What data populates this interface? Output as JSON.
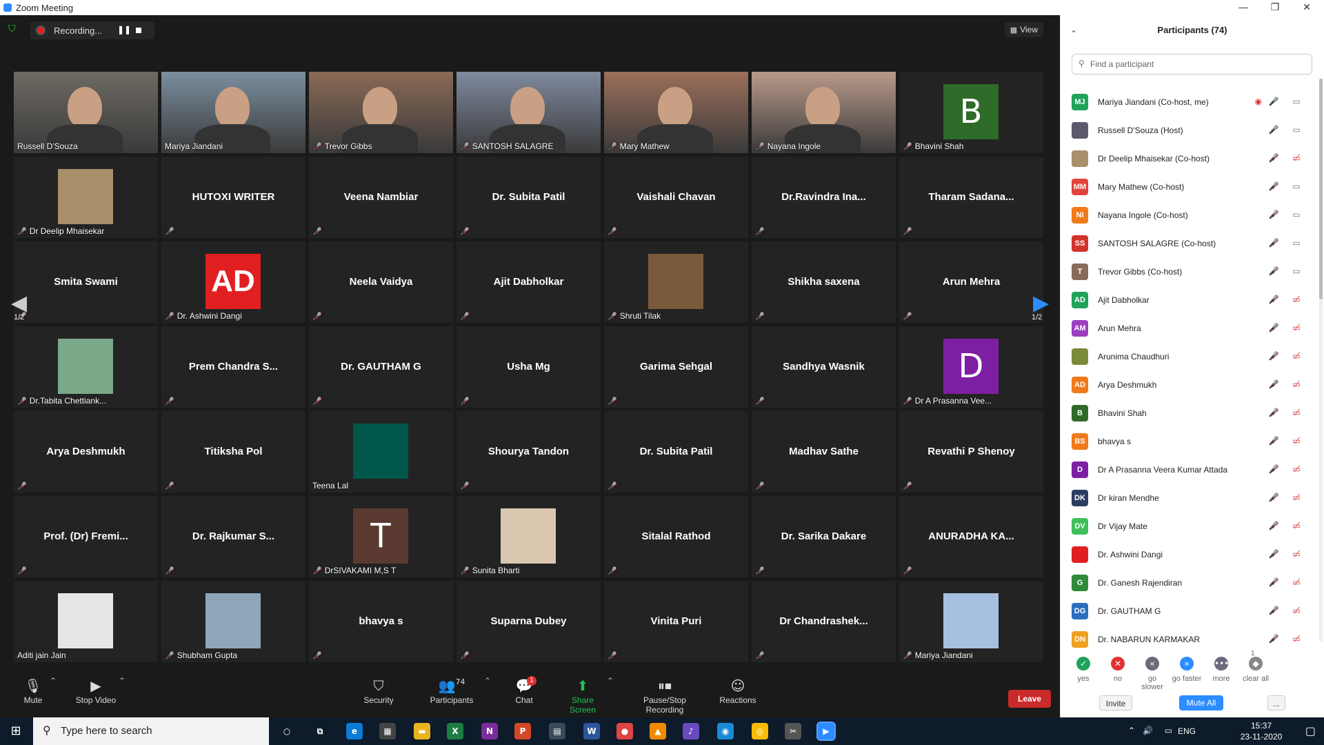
{
  "window": {
    "title": "Zoom Meeting"
  },
  "topbar": {
    "recording_label": "Recording...",
    "view_label": "View"
  },
  "pagination": {
    "left": "1/2",
    "right": "1/2"
  },
  "tiles": [
    {
      "name": "Russell D'Souza",
      "kind": "video",
      "muted": false,
      "bg": "#6e6a63"
    },
    {
      "name": "Mariya Jiandani",
      "kind": "video",
      "muted": false,
      "bg": "#7b8fa0",
      "active": true
    },
    {
      "name": "Trevor Gibbs",
      "kind": "video",
      "muted": true,
      "bg": "#8a6a55"
    },
    {
      "name": "SANTOSH SALAGRE",
      "kind": "video",
      "muted": true,
      "bg": "#7f8aa0"
    },
    {
      "name": "Mary Mathew",
      "kind": "video",
      "muted": true,
      "bg": "#9c6f5a"
    },
    {
      "name": "Nayana Ingole",
      "kind": "video",
      "muted": true,
      "bg": "#b99a8a"
    },
    {
      "name": "Bhavini Shah",
      "kind": "letter",
      "letter": "B",
      "color": "#2f6b28",
      "muted": true
    },
    {
      "name": "Dr Deelip Mhaisekar",
      "kind": "photo",
      "color": "#a98f6a",
      "muted": true
    },
    {
      "name": "HUTOXI WRITER",
      "kind": "text",
      "muted": true
    },
    {
      "name": "Veena Nambiar",
      "kind": "text",
      "muted": true
    },
    {
      "name": "Dr. Subita Patil",
      "kind": "text",
      "muted": true
    },
    {
      "name": "Vaishali Chavan",
      "kind": "text",
      "muted": true
    },
    {
      "name": "Dr.Ravindra  Ina...",
      "kind": "text",
      "muted": true
    },
    {
      "name": "Tharam  Sadana...",
      "kind": "text",
      "muted": true
    },
    {
      "name": "Smita Swami",
      "kind": "text",
      "muted": true
    },
    {
      "name": "Dr. Ashwini Dangi",
      "kind": "ad",
      "muted": true
    },
    {
      "name": "Neela Vaidya",
      "kind": "text",
      "muted": true
    },
    {
      "name": "Ajit Dabholkar",
      "kind": "text",
      "muted": true
    },
    {
      "name": "Shruti Tilak",
      "kind": "photo",
      "color": "#7a5a3a",
      "muted": true
    },
    {
      "name": "Shikha saxena",
      "kind": "text",
      "muted": true
    },
    {
      "name": "Arun Mehra",
      "kind": "text",
      "muted": true
    },
    {
      "name": "Dr.Tabita Chettiank...",
      "kind": "photo",
      "color": "#7aa98a",
      "muted": true
    },
    {
      "name": "Prem  Chandra  S...",
      "kind": "text",
      "muted": true
    },
    {
      "name": "Dr. GAUTHAM G",
      "kind": "text",
      "muted": true
    },
    {
      "name": "Usha Mg",
      "kind": "text",
      "muted": true
    },
    {
      "name": "Garima Sehgal",
      "kind": "text",
      "muted": true
    },
    {
      "name": "Sandhya Wasnik",
      "kind": "text",
      "muted": true
    },
    {
      "name": "Dr A Prasanna Vee...",
      "kind": "letter",
      "letter": "D",
      "color": "#7d1fa3",
      "muted": true
    },
    {
      "name": "Arya Deshmukh",
      "kind": "text",
      "muted": true
    },
    {
      "name": "Titiksha Pol",
      "kind": "text",
      "muted": true
    },
    {
      "name": "Teena Lal",
      "kind": "block",
      "color": "#00574a",
      "muted": false
    },
    {
      "name": "Shourya Tandon",
      "kind": "text",
      "muted": true
    },
    {
      "name": "Dr. Subita Patil",
      "kind": "text",
      "muted": true
    },
    {
      "name": "Madhav Sathe",
      "kind": "text",
      "muted": true
    },
    {
      "name": "Revathi P Shenoy",
      "kind": "text",
      "muted": true
    },
    {
      "name": "Prof. (Dr) Fremi...",
      "kind": "text",
      "muted": true
    },
    {
      "name": "Dr. Rajkumar  S...",
      "kind": "text",
      "muted": true
    },
    {
      "name": "DrSIVAKAMI M,S T",
      "kind": "letter",
      "letter": "T",
      "color": "#5a3a30",
      "muted": true
    },
    {
      "name": "Sunita Bharti",
      "kind": "photo",
      "color": "#d9c7b0",
      "muted": true
    },
    {
      "name": "Sitalal Rathod",
      "kind": "text",
      "muted": true
    },
    {
      "name": "Dr. Sarika Dakare",
      "kind": "text",
      "muted": true
    },
    {
      "name": "ANURADHA  KA...",
      "kind": "text",
      "muted": true
    },
    {
      "name": "Aditi jain Jain",
      "kind": "photo",
      "color": "#e6e6e6",
      "muted": false
    },
    {
      "name": "Shubham Gupta",
      "kind": "photo",
      "color": "#8fa6b8",
      "muted": true
    },
    {
      "name": "bhavya s",
      "kind": "text",
      "muted": true
    },
    {
      "name": "Suparna Dubey",
      "kind": "text",
      "muted": true
    },
    {
      "name": "Vinita Puri",
      "kind": "text",
      "muted": true
    },
    {
      "name": "Dr  Chandrashek...",
      "kind": "text",
      "muted": true
    },
    {
      "name": "Mariya Jiandani",
      "kind": "photo",
      "color": "#a8c0e0",
      "muted": true
    }
  ],
  "toolbar": {
    "mute": "Mute",
    "stop_video": "Stop Video",
    "security": "Security",
    "participants": "Participants",
    "participants_count": "74",
    "chat": "Chat",
    "chat_badge": "1",
    "share_screen": "Share Screen",
    "pause_recording": "Pause/Stop Recording",
    "reactions": "Reactions",
    "leave": "Leave"
  },
  "panel": {
    "title": "Participants (74)",
    "search_placeholder": "Find a participant",
    "participants": [
      {
        "initials": "MJ",
        "name": "Mariya Jiandani (Co-host, me)",
        "color": "#1fa35a",
        "mic": "on",
        "cam": "on",
        "rec": true
      },
      {
        "initials": "",
        "name": "Russell D'Souza (Host)",
        "color": "#5a5a6a",
        "mic": "on",
        "cam": "on"
      },
      {
        "initials": "",
        "name": "Dr Deelip Mhaisekar (Co-host)",
        "color": "#a98f6a",
        "mic": "off",
        "cam": "off"
      },
      {
        "initials": "MM",
        "name": "Mary Mathew (Co-host)",
        "color": "#e0443c",
        "mic": "off",
        "cam": "on"
      },
      {
        "initials": "NI",
        "name": "Nayana Ingole (Co-host)",
        "color": "#f07a1a",
        "mic": "off",
        "cam": "on"
      },
      {
        "initials": "SS",
        "name": "SANTOSH SALAGRE (Co-host)",
        "color": "#d0342c",
        "mic": "off",
        "cam": "on"
      },
      {
        "initials": "T",
        "name": "Trevor Gibbs (Co-host)",
        "color": "#8a6a5a",
        "mic": "off",
        "cam": "on"
      },
      {
        "initials": "AD",
        "name": "Ajit Dabholkar",
        "color": "#1fa35a",
        "mic": "off",
        "cam": "off"
      },
      {
        "initials": "AM",
        "name": "Arun Mehra",
        "color": "#9b3fbf",
        "mic": "off",
        "cam": "off"
      },
      {
        "initials": "",
        "name": "Arunima Chaudhuri",
        "color": "#7a8a3a",
        "mic": "off",
        "cam": "off"
      },
      {
        "initials": "AD",
        "name": "Arya Deshmukh",
        "color": "#f07a1a",
        "mic": "off",
        "cam": "off"
      },
      {
        "initials": "B",
        "name": "Bhavini Shah",
        "color": "#2f6b28",
        "mic": "off",
        "cam": "off"
      },
      {
        "initials": "BS",
        "name": "bhavya s",
        "color": "#f07a1a",
        "mic": "off",
        "cam": "off"
      },
      {
        "initials": "D",
        "name": "Dr A Prasanna Veera Kumar Attada",
        "color": "#7d1fa3",
        "mic": "off",
        "cam": "off"
      },
      {
        "initials": "DK",
        "name": "Dr kiran Mendhe",
        "color": "#2c3e60",
        "mic": "off",
        "cam": "off"
      },
      {
        "initials": "DV",
        "name": "Dr Vijay Mate",
        "color": "#3fbf5a",
        "mic": "off",
        "cam": "off"
      },
      {
        "initials": "",
        "name": "Dr. Ashwini Dangi",
        "color": "#e02020",
        "mic": "off",
        "cam": "off"
      },
      {
        "initials": "G",
        "name": "Dr. Ganesh Rajendiran",
        "color": "#2f8a3a",
        "mic": "off",
        "cam": "off"
      },
      {
        "initials": "DG",
        "name": "Dr. GAUTHAM G",
        "color": "#2a6fbf",
        "mic": "off",
        "cam": "off"
      },
      {
        "initials": "DN",
        "name": "Dr. NABARUN KARMAKAR",
        "color": "#f0a020",
        "mic": "off",
        "cam": "off"
      }
    ],
    "reactions": [
      {
        "label": "yes",
        "icon": "✓",
        "color": "#1fa35a"
      },
      {
        "label": "no",
        "icon": "✕",
        "color": "#e03131"
      },
      {
        "label": "go slower",
        "icon": "«",
        "color": "#6a6a7a"
      },
      {
        "label": "go faster",
        "icon": "»",
        "color": "#2d8cff"
      },
      {
        "label": "more",
        "icon": "•••",
        "color": "#6a6a7a"
      },
      {
        "label": "clear all",
        "icon": "◆",
        "color": "#888"
      }
    ],
    "more_count": "1",
    "invite": "Invite",
    "mute_all": "Mute All",
    "more_btn": "..."
  },
  "taskbar": {
    "search_placeholder": "Type here to search",
    "language": "ENG",
    "time": "15:37",
    "date": "23-11-2020"
  }
}
